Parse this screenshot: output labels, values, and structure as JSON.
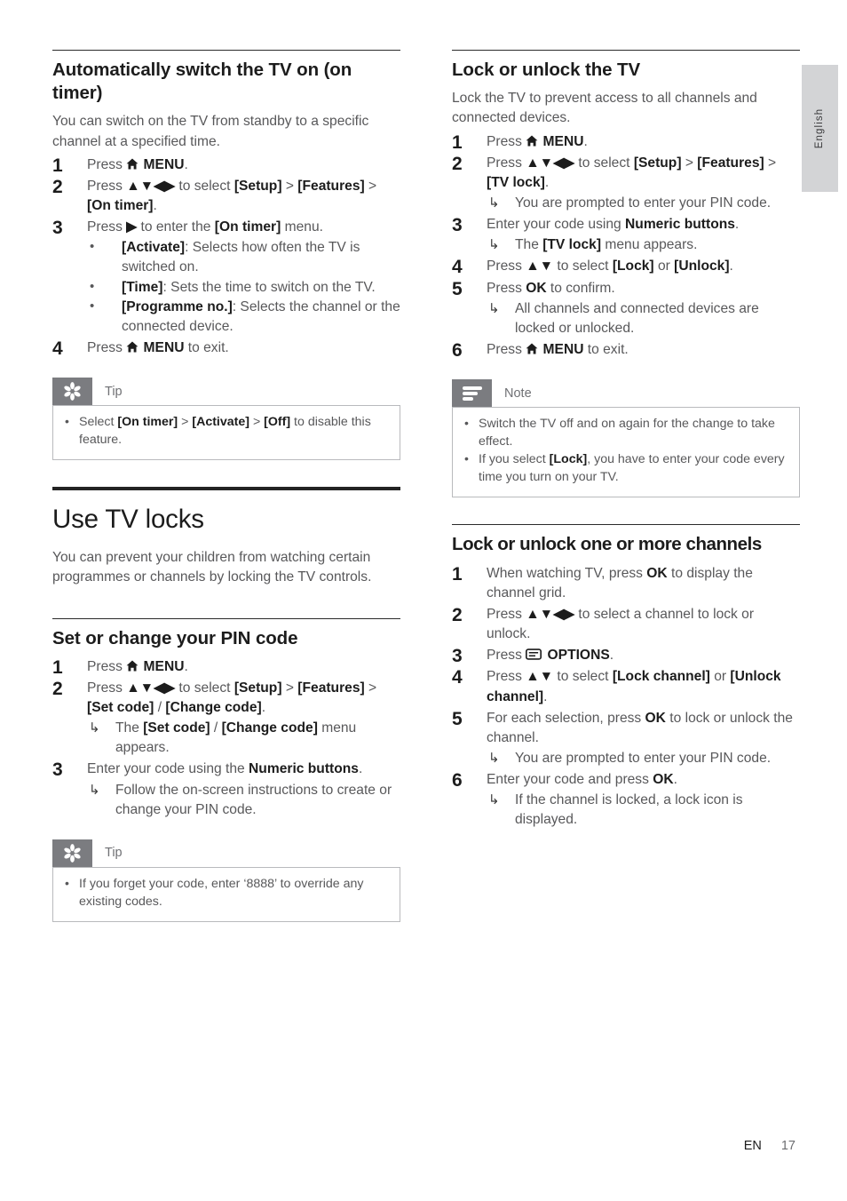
{
  "page": {
    "language_tab": "English",
    "footer": {
      "lang_code": "EN",
      "page_number": "17"
    }
  },
  "left_column": {
    "section_on_timer": {
      "heading": "Automatically switch the TV on (on timer)",
      "intro": "You can switch on the TV from standby to a specific channel at a specified time.",
      "steps": [
        {
          "num": "1",
          "text_html": "Press <span class=\"icon-home\" data-name=\"home-icon\"></span> <b>MENU</b>."
        },
        {
          "num": "2",
          "text_html": "Press <b>▲▼◀▶</b> to select <b>[Setup]</b> > <b>[Features]</b> > <b>[On timer]</b>."
        },
        {
          "num": "3",
          "text_html": "Press <b>▶</b> to enter the <b>[On timer]</b> menu.",
          "bullets": [
            "<b>[Activate]</b>: Selects how often the TV is switched on.",
            "<b>[Time]</b>: Sets the time to switch on the TV.",
            "<b>[Programme no.]</b>: Selects the channel or the connected device."
          ]
        },
        {
          "num": "4",
          "text_html": "Press <span class=\"icon-home\" data-name=\"home-icon\"></span> <b>MENU</b> to exit."
        }
      ],
      "tip": {
        "icon": "tip-asterisk-icon",
        "title": "Tip",
        "items": [
          "Select <b>[On timer]</b> > <b>[Activate]</b> > <b>[Off]</b> to disable this feature."
        ]
      }
    },
    "section_tv_locks": {
      "heading": "Use TV locks",
      "intro": "You can prevent your children from watching certain programmes or channels by locking the TV controls."
    },
    "section_pin_code": {
      "heading": "Set or change your PIN code",
      "steps": [
        {
          "num": "1",
          "text_html": "Press <span class=\"icon-home\" data-name=\"home-icon\"></span> <b>MENU</b>."
        },
        {
          "num": "2",
          "text_html": "Press <b>▲▼◀▶</b> to select <b>[Setup]</b> > <b>[Features]</b> > <b>[Set code]</b> / <b>[Change code]</b>.",
          "results": [
            "The <b>[Set code]</b> / <b>[Change code]</b> menu appears."
          ]
        },
        {
          "num": "3",
          "text_html": "Enter your code using the <b>Numeric buttons</b>.",
          "results": [
            "Follow the on-screen instructions to create or change your PIN code."
          ]
        }
      ],
      "tip": {
        "icon": "tip-asterisk-icon",
        "title": "Tip",
        "items": [
          "If you forget your code, enter ‘8888’ to override any existing codes."
        ]
      }
    }
  },
  "right_column": {
    "section_lock_tv": {
      "heading": "Lock or unlock the TV",
      "intro": "Lock the TV to prevent access to all channels and connected devices.",
      "steps": [
        {
          "num": "1",
          "text_html": "Press <span class=\"icon-home\" data-name=\"home-icon\"></span> <b>MENU</b>."
        },
        {
          "num": "2",
          "text_html": "Press <b>▲▼◀▶</b> to select <b>[Setup]</b> > <b>[Features]</b> > <b>[TV lock]</b>.",
          "results": [
            "You are prompted to enter your PIN code."
          ]
        },
        {
          "num": "3",
          "text_html": "Enter your code using <b>Numeric buttons</b>.",
          "results": [
            "The <b>[TV lock]</b> menu appears."
          ]
        },
        {
          "num": "4",
          "text_html": "Press <b>▲▼</b> to select <b>[Lock]</b> or <b>[Unlock]</b>."
        },
        {
          "num": "5",
          "text_html": "Press <b>OK</b> to confirm.",
          "results": [
            "All channels and connected devices are locked or unlocked."
          ]
        },
        {
          "num": "6",
          "text_html": "Press <span class=\"icon-home\" data-name=\"home-icon\"></span> <b>MENU</b> to exit."
        }
      ],
      "note": {
        "icon": "note-lines-icon",
        "title": "Note",
        "items": [
          "Switch the TV off and on again for the change to take effect.",
          "If you select <b>[Lock]</b>, you have to enter your code every time you turn on your TV."
        ]
      }
    },
    "section_lock_channels": {
      "heading": "Lock or unlock one or more channels",
      "steps": [
        {
          "num": "1",
          "text_html": "When watching TV, press <b>OK</b> to display the channel grid."
        },
        {
          "num": "2",
          "text_html": "Press <b>▲▼◀▶</b> to select a channel to lock or unlock."
        },
        {
          "num": "3",
          "text_html": "Press <span class=\"icon-options\" data-name=\"options-icon\"></span> <b>OPTIONS</b>."
        },
        {
          "num": "4",
          "text_html": "Press <b>▲▼</b> to select <b>[Lock channel]</b> or <b>[Unlock channel]</b>."
        },
        {
          "num": "5",
          "text_html": "For each selection, press <b>OK</b> to lock or unlock the channel.",
          "results": [
            "You are prompted to enter your PIN code."
          ]
        },
        {
          "num": "6",
          "text_html": "Enter your code and press <b>OK</b>.",
          "results": [
            "If the channel is locked, a lock icon is displayed."
          ]
        }
      ]
    }
  }
}
